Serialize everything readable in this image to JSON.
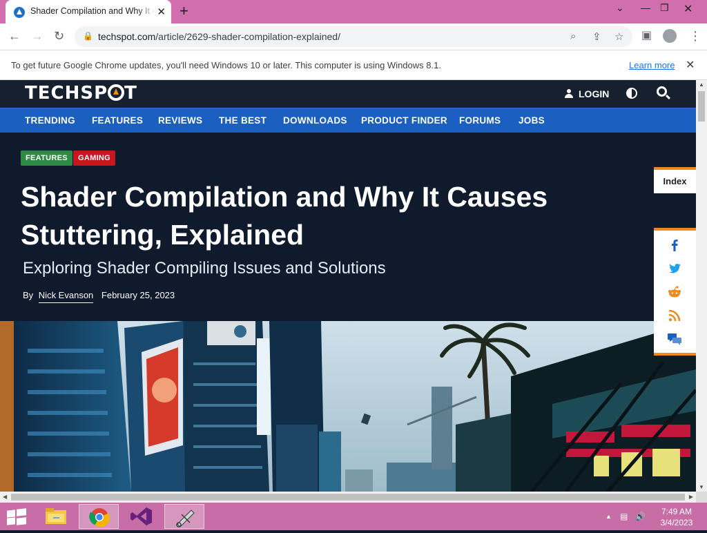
{
  "browser": {
    "tab_title": "Shader Compilation and Why It Causes Stuttering, Explained",
    "url_host": "techspot.com",
    "url_path": "/article/2629-shader-compilation-explained/",
    "infobar_message": "To get future Google Chrome updates, you'll need Windows 10 or later. This computer is using Windows 8.1.",
    "infobar_link": "Learn more"
  },
  "site": {
    "logo_text_a": "TECHSP",
    "logo_text_b": "T",
    "login_label": "LOGIN",
    "nav": [
      "TRENDING",
      "FEATURES",
      "REVIEWS",
      "THE BEST",
      "DOWNLOADS",
      "PRODUCT FINDER",
      "FORUMS",
      "JOBS"
    ],
    "accent_color": "#f08a1c",
    "nav_color": "#1b5fc1"
  },
  "article": {
    "badges": [
      "FEATURES",
      "GAMING"
    ],
    "headline": "Shader Compilation and Why It Causes Stuttering, Explained",
    "subtitle": "Exploring Shader Compiling Issues and Solutions",
    "by_label": "By",
    "author": "Nick Evanson",
    "date": "February 25, 2023"
  },
  "side_rail": {
    "index_label": "Index",
    "share_icons": [
      "facebook-icon",
      "twitter-icon",
      "reddit-icon",
      "rss-icon",
      "comments-icon"
    ]
  },
  "taskbar": {
    "time": "7:49 AM",
    "date": "3/4/2023",
    "apps": [
      "file-explorer-icon",
      "chrome-icon",
      "visual-studio-icon",
      "snipping-tool-icon"
    ]
  }
}
